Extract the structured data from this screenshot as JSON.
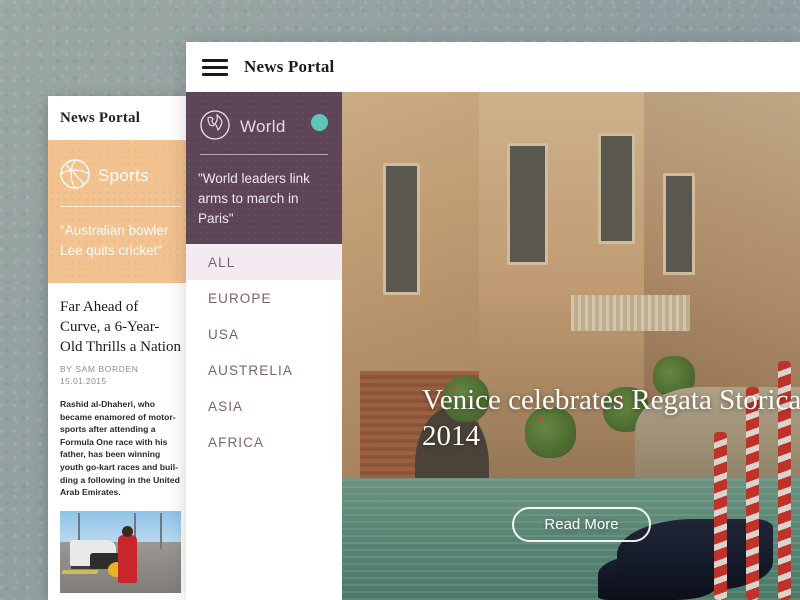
{
  "background": {
    "color_start": "#9aa8a4",
    "color_end": "#96a3a2"
  },
  "left_card": {
    "brand": "News Portal",
    "category": {
      "icon": "basketball-icon",
      "label": "Sports",
      "quote": "\"Australian bowler Lee quits cricket\"",
      "bg_color": "#f2c391"
    },
    "article": {
      "title": "Far Ahead of Curve, a 6-Year-Old Thrills a Nation",
      "byline": "BY SAM BORDEN",
      "date": "15.01.2015",
      "body": "Rashid al-Dhaheri, who became enamored of motor-sports after attending a Formula One race with his father, has been winning youth go-kart races and buil-ding a following in the United Arab Emirates.",
      "photo_alt": "young go-kart racer in red suit"
    }
  },
  "main_panel": {
    "topbar": {
      "menu_icon": "hamburger-menu-icon",
      "title": "News Portal"
    },
    "world": {
      "icon": "globe-icon",
      "label": "World",
      "badge_color": "#5ec6b6",
      "quote": "\"World leaders link arms to march in Paris\"",
      "bg_color": "#5d4456"
    },
    "nav": {
      "items": [
        {
          "label": "ALL",
          "active": true
        },
        {
          "label": "EUROPE",
          "active": false
        },
        {
          "label": "USA",
          "active": false
        },
        {
          "label": "AUSTRELIA",
          "active": false
        },
        {
          "label": "ASIA",
          "active": false
        },
        {
          "label": "AFRICA",
          "active": false
        }
      ],
      "active_bg": "#f4eaf1",
      "text_color": "#7c5f74"
    },
    "hero": {
      "title": "Venice celebrates Regata Storica 2014",
      "button_label": "Read More",
      "photo_alt": "Venice canal with gondolas and red mooring poles"
    }
  }
}
